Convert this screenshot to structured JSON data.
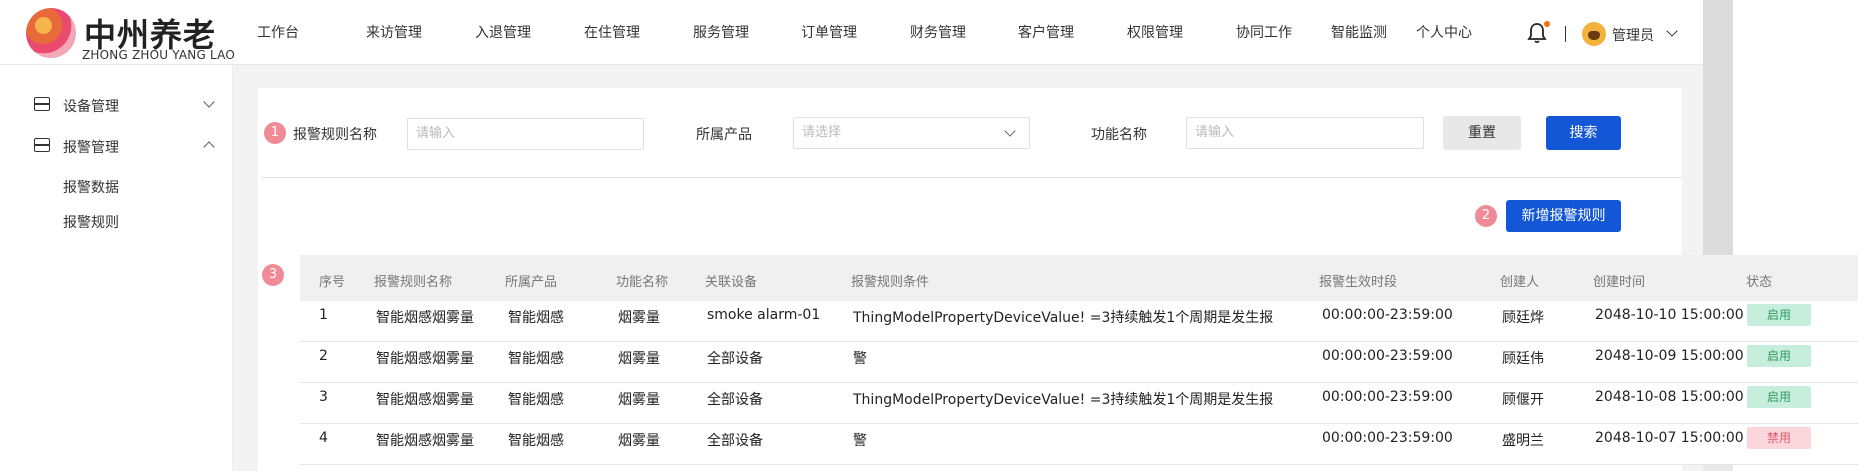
{
  "app": {
    "logo_title": "中州养老",
    "logo_subtitle": "ZHONG ZHOU YANG LAO",
    "user_name": "管理员"
  },
  "nav": [
    {
      "label": "工作台"
    },
    {
      "label": "来访管理"
    },
    {
      "label": "入退管理"
    },
    {
      "label": "在住管理"
    },
    {
      "label": "服务管理"
    },
    {
      "label": "订单管理"
    },
    {
      "label": "财务管理"
    },
    {
      "label": "客户管理"
    },
    {
      "label": "权限管理"
    },
    {
      "label": "协同工作"
    },
    {
      "label": "智能监测"
    },
    {
      "label": "个人中心"
    }
  ],
  "sidebar": {
    "groups": [
      {
        "label": "设备管理",
        "expanded": false,
        "icon": "server-icon"
      },
      {
        "label": "报警管理",
        "expanded": true,
        "icon": "server-icon"
      }
    ],
    "sub_items": [
      {
        "label": "报警数据"
      },
      {
        "label": "报警规则"
      }
    ]
  },
  "filters": {
    "rule_name_label": "报警规则名称",
    "rule_name_placeholder": "请输入",
    "product_label": "所属产品",
    "product_placeholder": "请选择",
    "function_label": "功能名称",
    "function_placeholder": "请输入",
    "reset_label": "重置",
    "search_label": "搜索"
  },
  "badges": {
    "b1": "1",
    "b2": "2",
    "b3": "3"
  },
  "add_rule_label": "新增报警规则",
  "table": {
    "headers": [
      "序号",
      "报警规则名称",
      "所属产品",
      "功能名称",
      "关联设备",
      "报警规则条件",
      "报警生效时段",
      "创建人",
      "创建时间",
      "状态"
    ],
    "rows": [
      {
        "no": "1",
        "rule": "智能烟感烟雾量",
        "product": "智能烟感",
        "func": "烟雾量",
        "device": "smoke alarm-01",
        "cond": "ThingModelPropertyDeviceValue!  =3持续触发1个周期是发生报",
        "period": "00:00:00-23:59:00",
        "creator": "顾廷烨",
        "time": "2048-10-10 15:00:00",
        "status": "启用",
        "status_color": "#2e9a62"
      },
      {
        "no": "2",
        "rule": "智能烟感烟雾量",
        "product": "智能烟感",
        "func": "烟雾量",
        "device": "全部设备",
        "cond": "警",
        "period": "00:00:00-23:59:00",
        "creator": "顾廷伟",
        "time": "2048-10-09 15:00:00",
        "status": "启用",
        "status_color": "#2e9a62"
      },
      {
        "no": "3",
        "rule": "智能烟感烟雾量",
        "product": "智能烟感",
        "func": "烟雾量",
        "device": "全部设备",
        "cond": "ThingModelPropertyDeviceValue!  =3持续触发1个周期是发生报",
        "period": "00:00:00-23:59:00",
        "creator": "顾偃开",
        "time": "2048-10-08 15:00:00",
        "status": "启用",
        "status_color": "#2e9a62"
      },
      {
        "no": "4",
        "rule": "智能烟感烟雾量",
        "product": "智能烟感",
        "func": "烟雾量",
        "device": "全部设备",
        "cond": "警",
        "period": "00:00:00-23:59:00",
        "creator": "盛明兰",
        "time": "2048-10-07 15:00:00",
        "status": "禁用",
        "status_color": "#e0596f"
      }
    ]
  }
}
